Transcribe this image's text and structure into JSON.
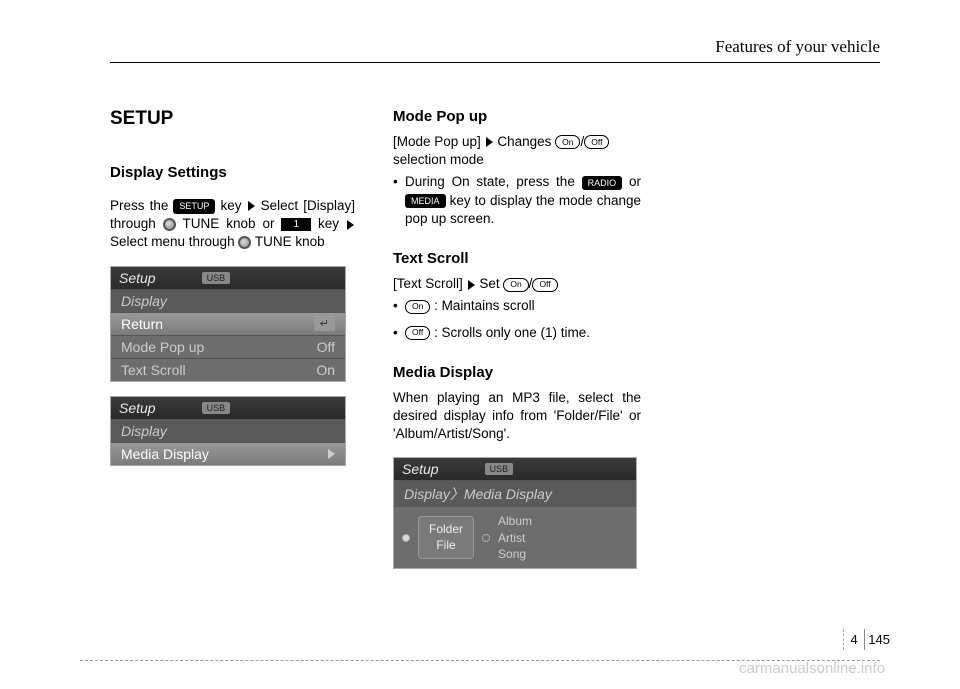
{
  "header": {
    "section_title": "Features of your vehicle"
  },
  "col1": {
    "h1": "SETUP",
    "h2": "Display Settings",
    "para_parts": {
      "p1a": "Press the ",
      "key_setup": "SETUP",
      "p1b": " key",
      "p1c": "Select [Display] through ",
      "p1d": " TUNE knob or ",
      "key_1": "1",
      "p1e": " key",
      "p1f": "Select menu through ",
      "p1g": " TUNE knob"
    },
    "screen1": {
      "top": "Setup",
      "badge": "USB",
      "r1": "Display",
      "r2": "Return",
      "r3l": "Mode Pop up",
      "r3r": "Off",
      "r4l": "Text Scroll",
      "r4r": "On"
    },
    "screen2": {
      "top": "Setup",
      "badge": "USB",
      "r1": "Display",
      "r2": "Media Display"
    }
  },
  "col2": {
    "mode_h": "Mode Pop up",
    "mode_p1a": "[Mode Pop up]",
    "mode_p1b": "Changes ",
    "pill_on": "On",
    "pill_off": "Off",
    "mode_p1c": "selection mode",
    "mode_b1a": "During On state, press the ",
    "key_radio": "RADIO",
    "mode_b1b": " or ",
    "key_media": "MEDIA",
    "mode_b1c": " key to display the mode change pop up screen.",
    "text_h": "Text Scroll",
    "text_p1a": "[Text Scroll]",
    "text_p1b": "Set ",
    "text_b1": " : Maintains scroll",
    "text_b2": " : Scrolls only one (1) time.",
    "media_h": "Media Display",
    "media_p": "When playing an MP3 file, select the desired display info from 'Folder/File' or 'Album/Artist/Song'.",
    "screen3": {
      "top": "Setup",
      "badge": "USB",
      "crumb": "Display〉Media Display",
      "opt1a": "Folder",
      "opt1b": "File",
      "opt2a": "Album",
      "opt2b": "Artist",
      "opt2c": "Song"
    }
  },
  "footer": {
    "chapter": "4",
    "page": "145",
    "watermark": "carmanualsonline.info"
  }
}
